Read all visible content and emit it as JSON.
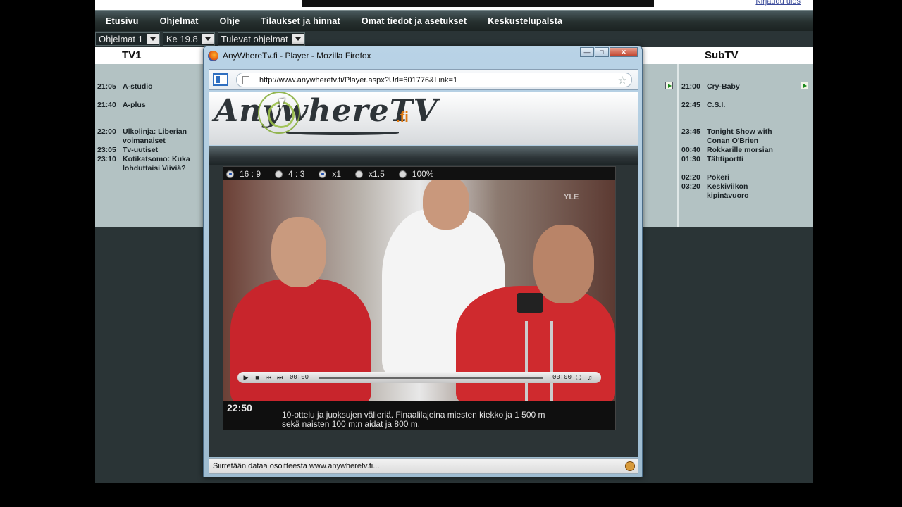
{
  "page": {
    "logout": "Kirjaudu ulos",
    "nav": [
      "Etusivu",
      "Ohjelmat",
      "Ohje",
      "Tilaukset ja hinnat",
      "Omat tiedot ja asetukset",
      "Keskustelupalsta"
    ],
    "filters": [
      "Ohjelmat 1",
      "Ke 19.8",
      "Tulevat ohjelmat"
    ],
    "tv1": {
      "name": "TV1",
      "programs": [
        {
          "time": "21:05",
          "title": "A-studio"
        },
        {
          "time": "21:40",
          "title": "A-plus"
        },
        {
          "time": "22:00",
          "title": "Ulkolinja: Liberian voimanaiset"
        },
        {
          "time": "23:05",
          "title": "Tv-uutiset"
        },
        {
          "time": "23:10",
          "title": "Kotikatsomo: Kuka lohduttaisi Viiviä?"
        }
      ]
    },
    "subtv": {
      "name": "SubTV",
      "programs": [
        {
          "time": "21:00",
          "title": "Cry-Baby"
        },
        {
          "time": "22:45",
          "title": "C.S.I."
        },
        {
          "time": "23:45",
          "title": "Tonight Show with Conan O'Brien"
        },
        {
          "time": "00:40",
          "title": "Rokkarille morsian"
        },
        {
          "time": "01:30",
          "title": "Tähtiportti"
        },
        {
          "time": "02:20",
          "title": "Pokeri"
        },
        {
          "time": "03:20",
          "title": "Keskiviikon kipinävuoro"
        }
      ]
    }
  },
  "window": {
    "title": "AnyWhereTv.fi - Player - Mozilla Firefox",
    "url": "http://www.anywheretv.fi/Player.aspx?Url=601776&Link=1",
    "status": "Siirretään dataa osoitteesta www.anywheretv.fi...",
    "logo_main": "AnywhereTV",
    "logo_suffix": ".fi"
  },
  "player": {
    "options": [
      {
        "label": "16 : 9",
        "selected": true
      },
      {
        "label": "4 : 3",
        "selected": false
      },
      {
        "label": "x1",
        "selected": true
      },
      {
        "label": "x1.5",
        "selected": false
      },
      {
        "label": "100%",
        "selected": false
      }
    ],
    "time_current": "00:00",
    "time_total": "00:00",
    "channel_watermark": "YLE",
    "epg_time": "22:50",
    "epg_desc_line1": "10-ottelu ja juoksujen välieriä. Finaalilajeina miesten kiekko ja 1 500 m",
    "epg_desc_line2": "sekä naisten 100 m:n aidat ja 800 m."
  },
  "colors": {
    "nav_bg": "#26302f",
    "channel_bg": "#b3c2c3",
    "logo_accent": "#e07a12",
    "play_icon": "#1a8a1a"
  }
}
